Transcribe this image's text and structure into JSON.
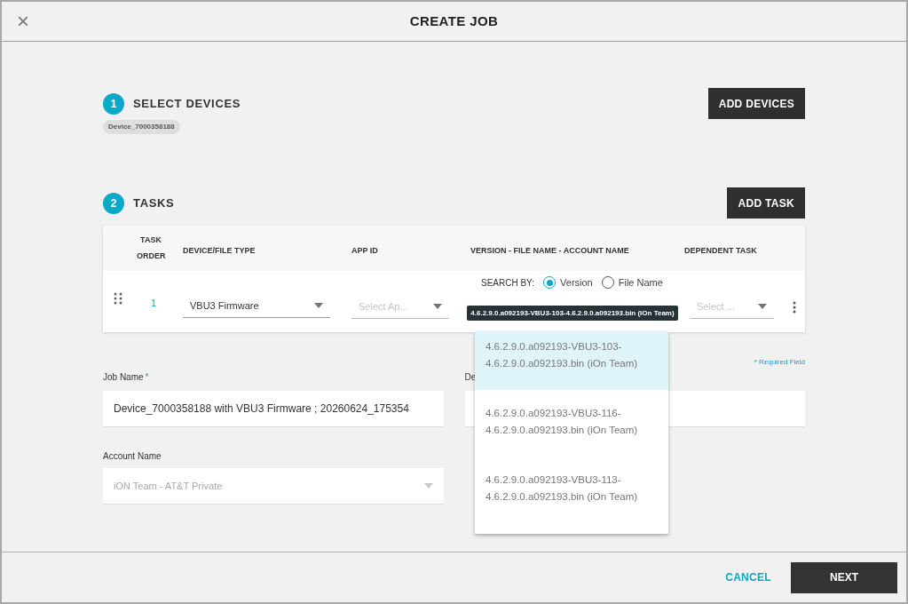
{
  "dialog": {
    "title": "CREATE JOB",
    "close_icon": "×"
  },
  "steps": [
    {
      "number": "1",
      "title": "SELECT DEVICES",
      "button": "ADD DEVICES"
    },
    {
      "number": "2",
      "title": "TASKS",
      "button": "ADD TASK"
    }
  ],
  "devices": [
    "Device_7000358188"
  ],
  "table": {
    "columns": [
      {
        "label": "TASK ORDER"
      },
      {
        "label": "DEVICE/FILE TYPE"
      },
      {
        "label": "APP ID"
      },
      {
        "label": "VERSION - FILE NAME - ACCOUNT NAME"
      },
      {
        "label": "DEPENDENT TASK"
      }
    ],
    "rows": [
      {
        "order": "1",
        "device_type": "VBU3 Firmware",
        "app_id": {
          "placeholder": "Select Ap..."
        },
        "search_label": "SEARCH BY:",
        "search_options": [
          {
            "label": "Version",
            "selected": true
          },
          {
            "label": "File Name",
            "selected": false
          }
        ],
        "dependent_task": {
          "placeholder": "Select ..."
        }
      }
    ]
  },
  "tooltip": "4.6.2.9.0.a092193-VBU3-103-4.6.2.9.0.a092193.bin (iOn Team)",
  "dropdown": [
    {
      "label": "4.6.2.9.0.a092193-VBU3-103-4.6.2.9.0.a092193.bin (iOn Team)",
      "selected": true
    },
    {
      "label": "4.6.2.9.0.a092193-VBU3-116-4.6.2.9.0.a092193.bin (iOn Team)",
      "selected": false
    },
    {
      "label": "4.6.2.9.0.a092193-VBU3-113-4.6.2.9.0.a092193.bin (iOn Team)",
      "selected": false
    }
  ],
  "required_note": "* Required Field",
  "form": {
    "job_name": {
      "label": "Job Name",
      "required_mark": "*",
      "value": "Device_7000358188 with VBU3 Firmware ; 20260624_175354"
    },
    "description": {
      "label": "De"
    },
    "account_name": {
      "label": "Account Name",
      "value": "iON Team - AT&T Private",
      "disabled": true
    }
  },
  "footer": {
    "cancel": "CANCEL",
    "next": "NEXT"
  }
}
